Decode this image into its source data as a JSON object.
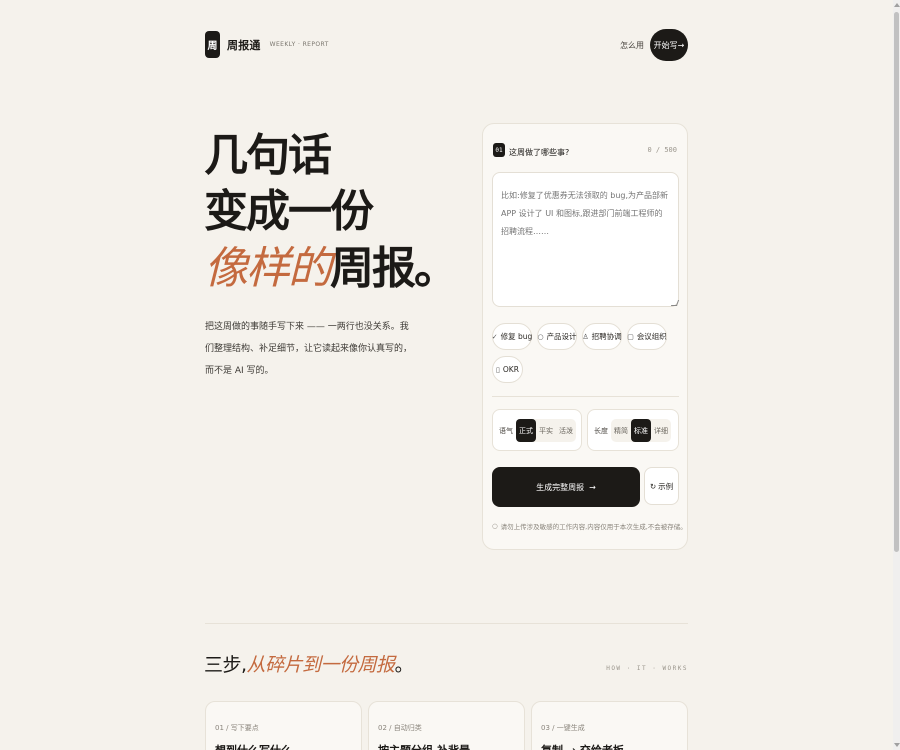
{
  "header": {
    "logo_mark": "周",
    "logo_name": "周报通",
    "logo_sub": "WEEKLY · REPORT",
    "nav_how": "怎么用",
    "nav_start": "开始写→"
  },
  "hero": {
    "line1": "几句话",
    "line2": "变成一份",
    "line3_accent": "像样的",
    "line3_rest": "周报。",
    "description": "把这周做的事随手写下来 —— 一两行也没关系。我们整理结构、补足细节，让它读起来像你认真写的，而不是 AI 写的。"
  },
  "card": {
    "step": "01",
    "question": "这周做了哪些事?",
    "counter": "0 / 500",
    "placeholder": "比如:修复了优惠券无法领取的 bug,为产品部新 APP 设计了 UI 和图标,跟进部门前端工程师的招聘流程……",
    "chips": [
      {
        "icon": "✓",
        "label": "修复 bug"
      },
      {
        "icon": "○",
        "label": "产品设计"
      },
      {
        "icon": "♙",
        "label": "招聘协调"
      },
      {
        "icon": "▢",
        "label": "会议组织"
      },
      {
        "icon": "▯",
        "label": "OKR"
      }
    ],
    "tone": {
      "label": "语气",
      "options": [
        "正式",
        "平实",
        "活泼"
      ],
      "selected": "正式"
    },
    "length": {
      "label": "长度",
      "options": [
        "精简",
        "标准",
        "详细"
      ],
      "selected": "标准"
    },
    "generate": "生成完整周报",
    "generate_arrow": "→",
    "example_icon": "↻",
    "example": "示例",
    "note_icon": "○",
    "note": "请勿上传涉及敏感的工作内容,内容仅用于本次生成,不会被存储。"
  },
  "section2": {
    "title_prefix": "三步,",
    "title_accent": "从碎片到一份周报",
    "title_suffix": "。",
    "kicker": "HOW · IT · WORKS",
    "steps": [
      {
        "num": "01 / 写下要点",
        "head": "想到什么写什么"
      },
      {
        "num": "02 / 自动归类",
        "head": "按主题分组,补背景"
      },
      {
        "num": "03 / 一键生成",
        "head": "复制 → 交给老板"
      }
    ]
  }
}
